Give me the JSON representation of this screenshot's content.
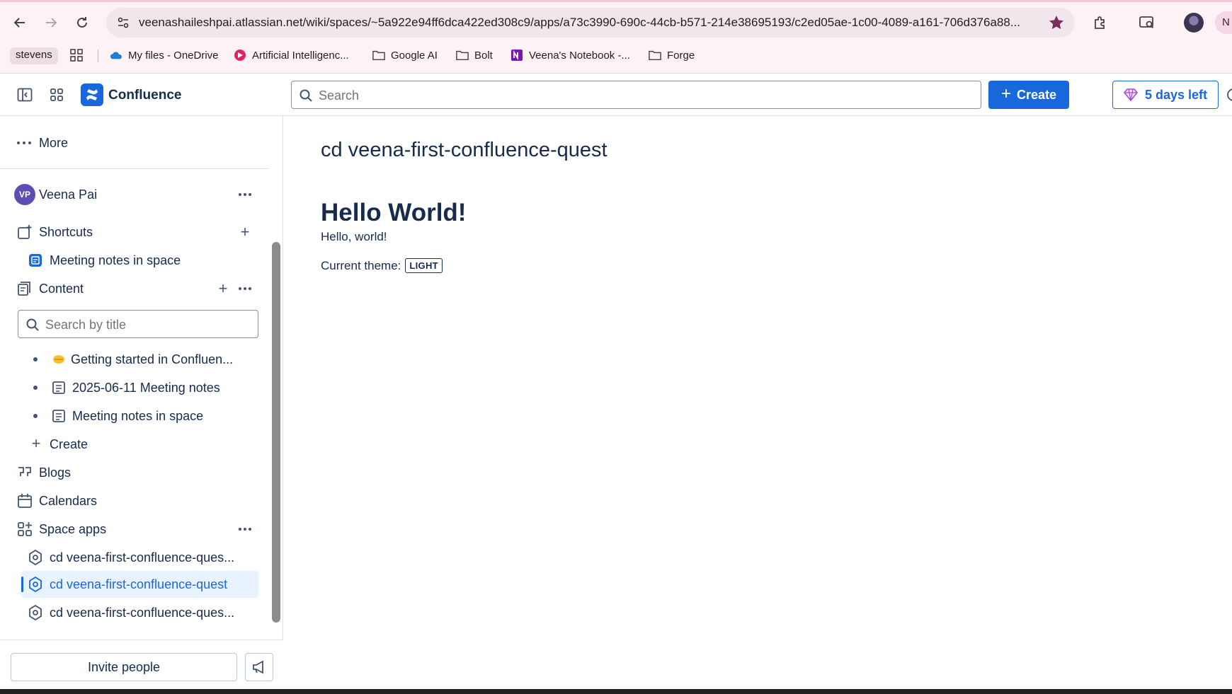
{
  "browser": {
    "url": "veenashaileshpai.atlassian.net/wiki/spaces/~5a922e94ff6dca422ed308c9/apps/a73c3990-690c-44cb-b571-214e38695193/c2ed05ae-1c00-4089-a161-706d376a88...",
    "profile_initial": "N",
    "bookmarks": {
      "stevens": "stevens",
      "onedrive": "My files - OneDrive",
      "ai": "Artificial Intelligenc...",
      "google_ai": "Google AI",
      "bolt": "Bolt",
      "notebook": "Veena's Notebook -...",
      "forge": "Forge"
    }
  },
  "topnav": {
    "brand": "Confluence",
    "search_placeholder": "Search",
    "create_label": "Create",
    "trial_label": "5 days left"
  },
  "sidebar": {
    "more_label": "More",
    "user_initials": "VP",
    "user_name": "Veena Pai",
    "shortcuts_label": "Shortcuts",
    "shortcut_item": "Meeting notes in space",
    "content_label": "Content",
    "search_placeholder": "Search by title",
    "content_items": [
      "Getting started in Confluen...",
      "2025-06-11 Meeting notes",
      "Meeting notes in space"
    ],
    "create_label": "Create",
    "blogs_label": "Blogs",
    "calendars_label": "Calendars",
    "space_apps_label": "Space apps",
    "space_apps": [
      "cd veena-first-confluence-ques...",
      "cd veena-first-confluence-quest",
      "cd veena-first-confluence-ques..."
    ],
    "invite_label": "Invite people"
  },
  "main": {
    "app_title": "cd veena-first-confluence-quest",
    "heading": "Hello World!",
    "paragraph": "Hello, world!",
    "theme_label": "Current theme:",
    "theme_value": "LIGHT"
  },
  "colors": {
    "accent": "#1868db",
    "selected_bg": "#e9f2ff",
    "text": "#172b4d"
  }
}
